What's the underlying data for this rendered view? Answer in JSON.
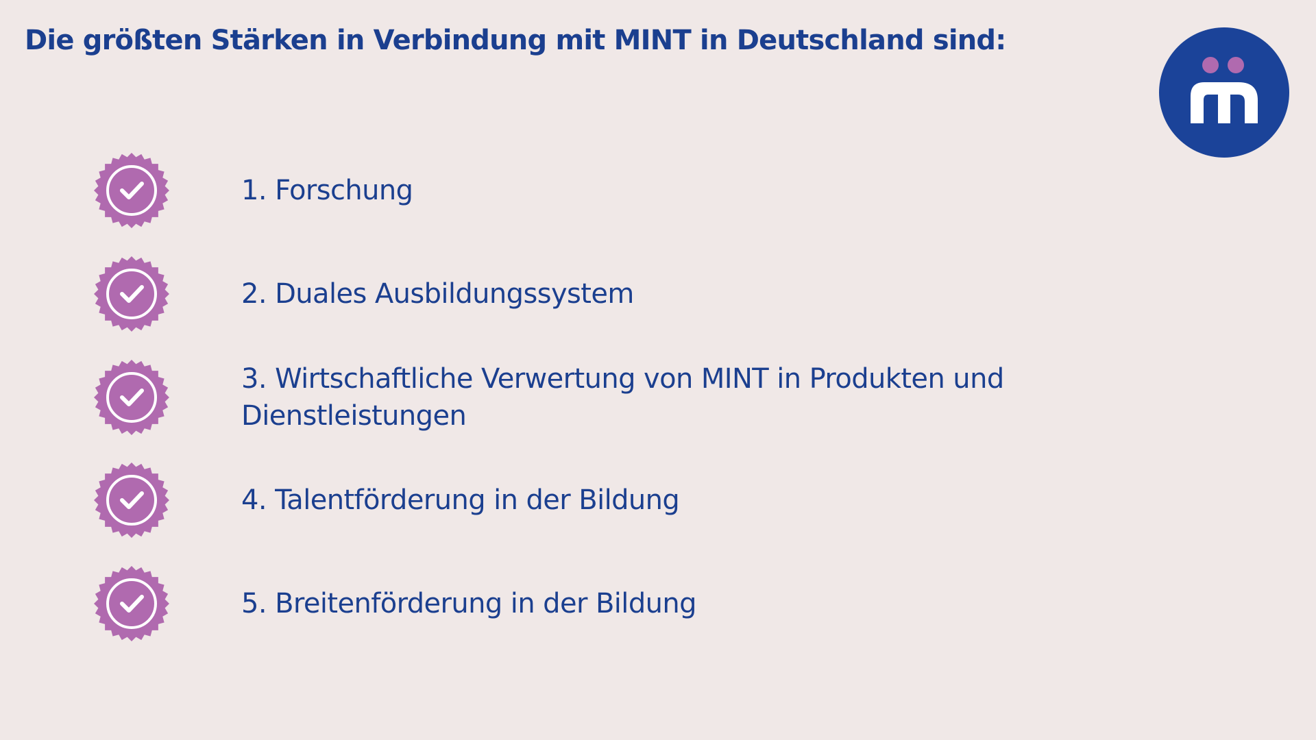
{
  "slide": {
    "title": "Die größten Stärken in Verbindung mit MINT in Deutschland sind:",
    "logo_icon": "m-with-two-dots-logo",
    "items": [
      {
        "label": "1. Forschung",
        "icon": "check-badge-icon"
      },
      {
        "label": "2. Duales Ausbildungssystem",
        "icon": "check-badge-icon"
      },
      {
        "label": "3. Wirtschaftliche Verwertung von MINT in Produkten und Dienstleistungen",
        "icon": "check-badge-icon"
      },
      {
        "label": "4. Talentförderung in der Bildung",
        "icon": "check-badge-icon"
      },
      {
        "label": "5. Breitenförderung in der Bildung",
        "icon": "check-badge-icon"
      }
    ]
  },
  "colors": {
    "background": "#f0e8e7",
    "text": "#1b3f8f",
    "badge": "#b06aaf",
    "logo_circle": "#1b4399",
    "logo_dots": "#b06aaf"
  }
}
